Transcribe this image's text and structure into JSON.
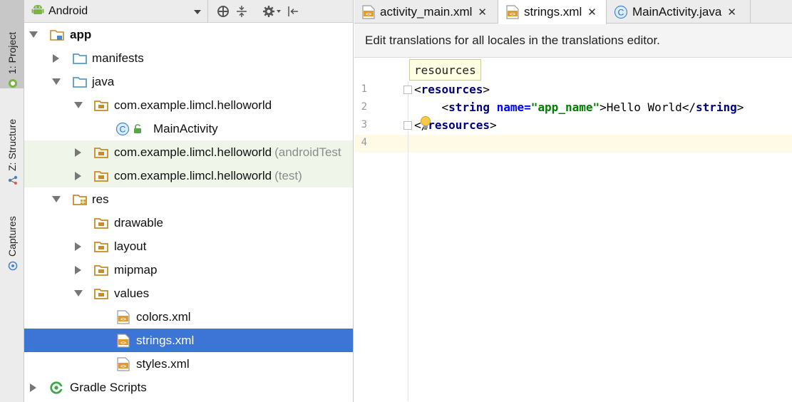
{
  "left_strip": {
    "project_label": "1: Project",
    "structure_label": "Z: Structure",
    "captures_label": "Captures"
  },
  "project_panel": {
    "view_selector": "Android",
    "tree": [
      {
        "label": "app",
        "bold": true
      },
      {
        "label": "manifests"
      },
      {
        "label": "java"
      },
      {
        "label": "com.example.limcl.helloworld"
      },
      {
        "label": "MainActivity"
      },
      {
        "label": "com.example.limcl.helloworld",
        "suffix": "(androidTest"
      },
      {
        "label": "com.example.limcl.helloworld",
        "suffix": "(test)"
      },
      {
        "label": "res"
      },
      {
        "label": "drawable"
      },
      {
        "label": "layout"
      },
      {
        "label": "mipmap"
      },
      {
        "label": "values"
      },
      {
        "label": "colors.xml"
      },
      {
        "label": "strings.xml"
      },
      {
        "label": "styles.xml"
      },
      {
        "label": "Gradle Scripts"
      }
    ]
  },
  "editor": {
    "tabs": [
      {
        "label": "activity_main.xml",
        "close": "✕"
      },
      {
        "label": "strings.xml",
        "close": "✕"
      },
      {
        "label": "MainActivity.java",
        "close": "✕"
      }
    ],
    "banner": "Edit translations for all locales in the translations editor.",
    "breadcrumb": "resources",
    "line_numbers": [
      "1",
      "2",
      "3",
      "4"
    ],
    "code": {
      "l1_open": "<",
      "l1_tag": "resources",
      "l1_close": ">",
      "l2_indent": "    ",
      "l2_lt": "<",
      "l2_tag": "string",
      "l2_sp": " ",
      "l2_attr": "name=",
      "l2_val": "\"app_name\"",
      "l2_gt": ">",
      "l2_text": "Hello World",
      "l2_end_open": "</",
      "l2_end_tag": "string",
      "l2_end_gt": ">",
      "l3_open": "</",
      "l3_tag": "resources",
      "l3_close": ">"
    }
  },
  "colors": {
    "selection": "#3d75d6",
    "test_source_bg": "#eff6e9",
    "folder_blue": "#5a9ac5",
    "package_orange": "#c88a2b"
  }
}
